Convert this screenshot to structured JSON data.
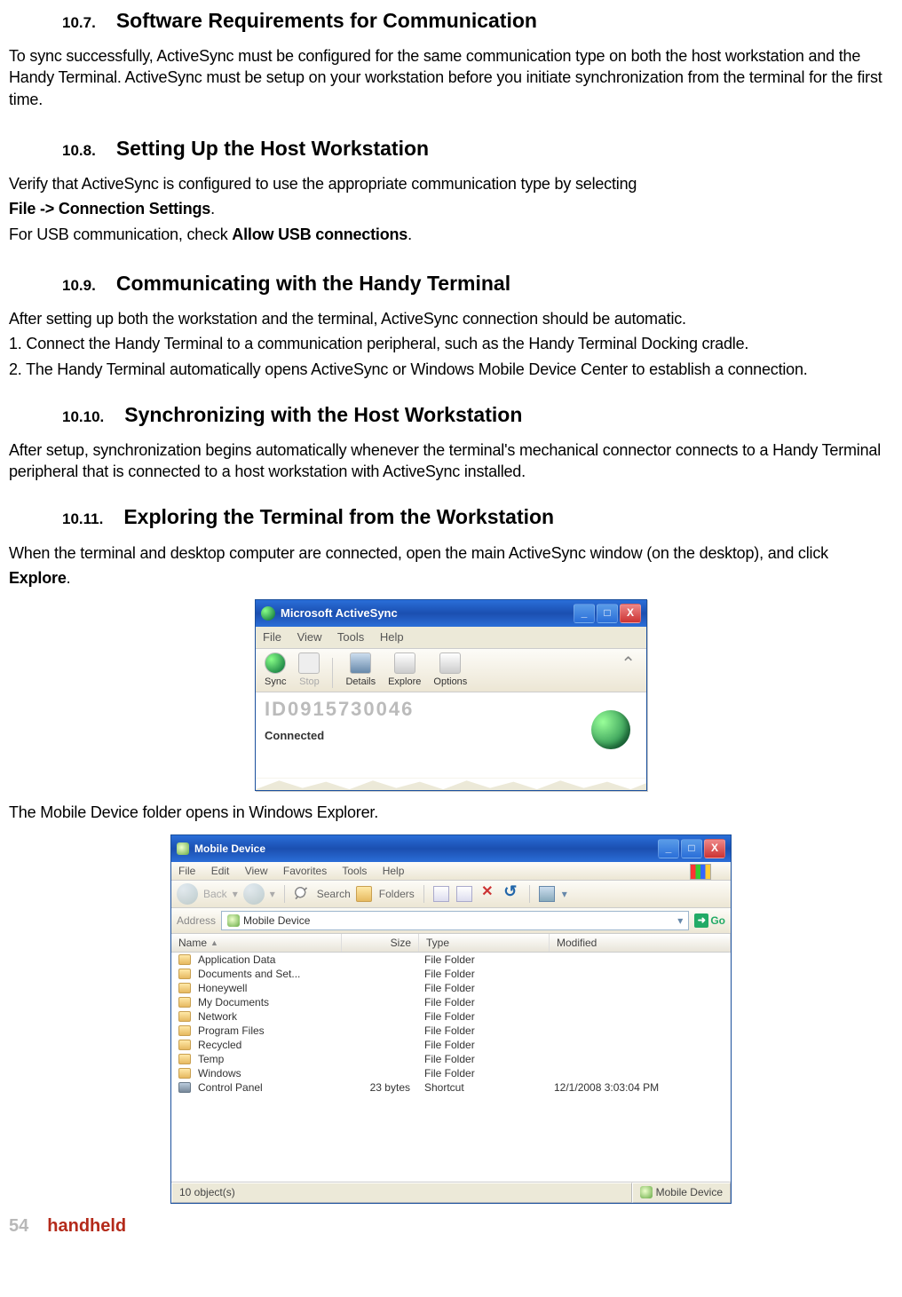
{
  "sections": {
    "s107": {
      "num": "10.7.",
      "title": "Software Requirements for Communication",
      "body": "To sync successfully, ActiveSync must be configured for the same communication type on both the host workstation and the Handy Terminal. ActiveSync must be setup on your workstation before you initiate synchronization from the terminal for the first time."
    },
    "s108": {
      "num": "10.8.",
      "title": "Setting Up the Host Workstation",
      "l1": "Verify that ActiveSync is configured to use the appropriate communication type by selecting",
      "l2a": "File -> Connection Settings",
      "l2b": ".",
      "l3a": "For USB communication, check ",
      "l3b": "Allow USB connections",
      "l3c": "."
    },
    "s109": {
      "num": "10.9.",
      "title": "Communicating with the Handy Terminal",
      "l1": "After setting up both the workstation and the terminal, ActiveSync connection should be automatic.",
      "l2": "1. Connect the Handy Terminal to a communication peripheral, such as the Handy Terminal Docking cradle.",
      "l3": "2. The Handy Terminal automatically opens ActiveSync or Windows Mobile Device Center to establish a connection."
    },
    "s1010": {
      "num": "10.10.",
      "title": "Synchronizing with the Host Workstation",
      "body": "After setup, synchronization begins automatically whenever the terminal's mechanical connector connects to a Handy Terminal peripheral that is connected to a host workstation with ActiveSync installed."
    },
    "s1011": {
      "num": "10.11.",
      "title": "Exploring the Terminal from the Workstation",
      "l1a": "When the terminal and desktop computer are connected, open the main ActiveSync window (on the desktop), and click",
      "l1b": "Explore",
      "l1c": ".",
      "l2": "The Mobile Device folder opens in Windows Explorer."
    }
  },
  "activesync": {
    "title": "Microsoft ActiveSync",
    "menu": [
      "File",
      "View",
      "Tools",
      "Help"
    ],
    "toolbar": {
      "sync": "Sync",
      "stop": "Stop",
      "details": "Details",
      "explore": "Explore",
      "options": "Options"
    },
    "device_id": "ID0915730046",
    "status": "Connected",
    "win_min": "_",
    "win_max": "□",
    "win_close": "X"
  },
  "explorer": {
    "title": "Mobile Device",
    "menu": [
      "File",
      "Edit",
      "View",
      "Favorites",
      "Tools",
      "Help"
    ],
    "back": "Back",
    "search": "Search",
    "folders": "Folders",
    "address_label": "Address",
    "address_value": "Mobile Device",
    "go": "Go",
    "columns": {
      "name": "Name",
      "size": "Size",
      "type": "Type",
      "modified": "Modified"
    },
    "rows": [
      {
        "icon": "folder",
        "name": "Application Data",
        "size": "",
        "type": "File Folder",
        "modified": ""
      },
      {
        "icon": "folder",
        "name": "Documents and Set...",
        "size": "",
        "type": "File Folder",
        "modified": ""
      },
      {
        "icon": "folder",
        "name": "Honeywell",
        "size": "",
        "type": "File Folder",
        "modified": ""
      },
      {
        "icon": "folder",
        "name": "My Documents",
        "size": "",
        "type": "File Folder",
        "modified": ""
      },
      {
        "icon": "folder",
        "name": "Network",
        "size": "",
        "type": "File Folder",
        "modified": ""
      },
      {
        "icon": "folder",
        "name": "Program Files",
        "size": "",
        "type": "File Folder",
        "modified": ""
      },
      {
        "icon": "folder",
        "name": "Recycled",
        "size": "",
        "type": "File Folder",
        "modified": ""
      },
      {
        "icon": "folder",
        "name": "Temp",
        "size": "",
        "type": "File Folder",
        "modified": ""
      },
      {
        "icon": "folder",
        "name": "Windows",
        "size": "",
        "type": "File Folder",
        "modified": ""
      },
      {
        "icon": "cp",
        "name": "Control Panel",
        "size": "23 bytes",
        "type": "Shortcut",
        "modified": "12/1/2008  3:03:04 PM"
      }
    ],
    "status_left": "10 object(s)",
    "status_right": "Mobile Device",
    "win_min": "_",
    "win_max": "□",
    "win_close": "X"
  },
  "footer": {
    "page": "54",
    "brand": "handheld"
  }
}
